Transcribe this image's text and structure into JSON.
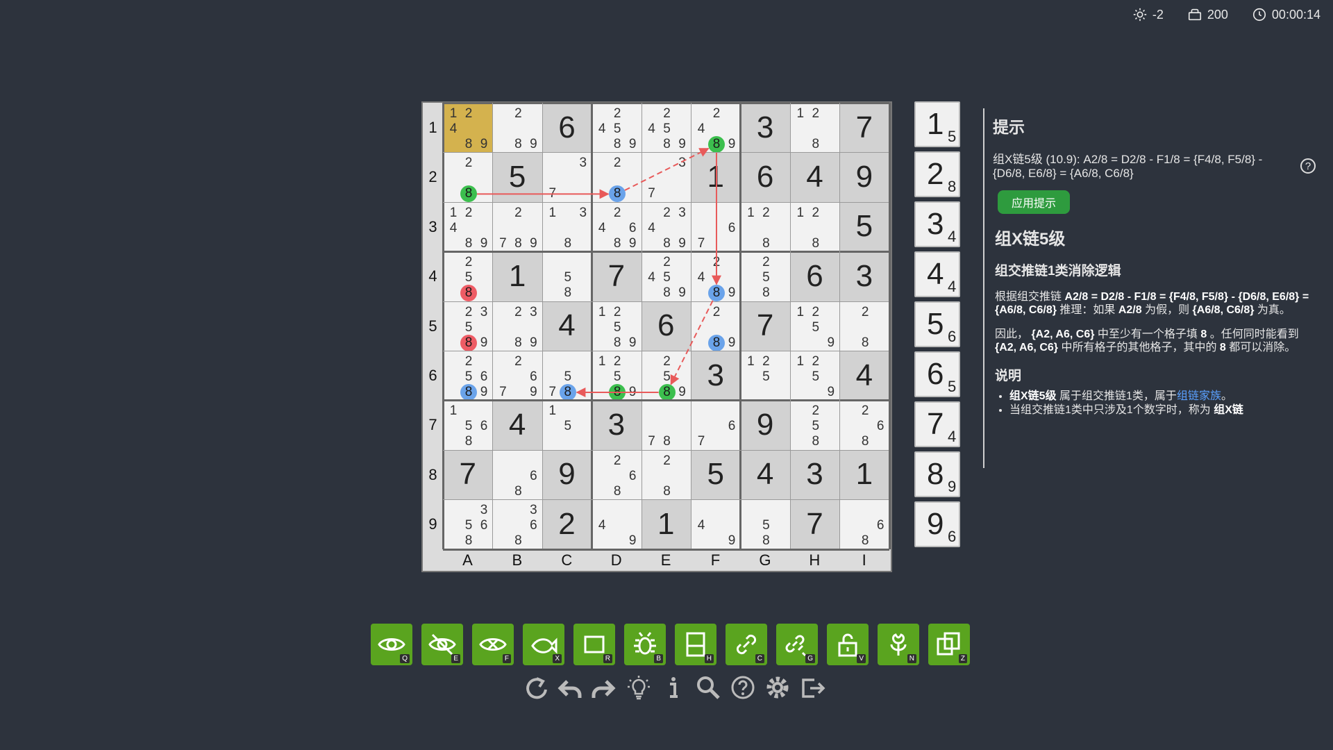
{
  "stats": {
    "brightness": "-2",
    "coins": "200",
    "timer": "00:00:14"
  },
  "board": {
    "row_labels": [
      "1",
      "2",
      "3",
      "4",
      "5",
      "6",
      "7",
      "8",
      "9"
    ],
    "col_labels": [
      "A",
      "B",
      "C",
      "D",
      "E",
      "F",
      "G",
      "H",
      "I"
    ],
    "selected": {
      "r": 0,
      "c": 0
    },
    "cells": [
      [
        {
          "c": [
            1,
            2,
            4,
            8,
            9
          ]
        },
        {
          "c": [
            2,
            8,
            9
          ]
        },
        {
          "v": 6
        },
        {
          "c": [
            2,
            4,
            5,
            8,
            9
          ]
        },
        {
          "c": [
            2,
            4,
            5,
            8,
            9
          ]
        },
        {
          "c": [
            2,
            4,
            8,
            9
          ],
          "hl": {
            "8": "green"
          }
        },
        {
          "v": 3
        },
        {
          "c": [
            1,
            2,
            8
          ]
        },
        {
          "v": 7
        }
      ],
      [
        {
          "c": [
            2,
            8
          ],
          "hl": {
            "8": "green"
          }
        },
        {
          "v": 5
        },
        {
          "c": [
            3,
            7
          ]
        },
        {
          "c": [
            2,
            8
          ],
          "hl": {
            "8": "blue"
          }
        },
        {
          "c": [
            3,
            7
          ]
        },
        {
          "v": 1
        },
        {
          "v": 6
        },
        {
          "v": 4
        },
        {
          "v": 9
        }
      ],
      [
        {
          "c": [
            1,
            2,
            4,
            8,
            9
          ]
        },
        {
          "c": [
            2,
            7,
            8,
            9
          ]
        },
        {
          "c": [
            1,
            3,
            8
          ]
        },
        {
          "c": [
            2,
            4,
            6,
            8,
            9
          ]
        },
        {
          "c": [
            2,
            3,
            4,
            8,
            9
          ]
        },
        {
          "c": [
            6,
            7
          ]
        },
        {
          "c": [
            1,
            2,
            8
          ]
        },
        {
          "c": [
            1,
            2,
            8
          ]
        },
        {
          "v": 5
        }
      ],
      [
        {
          "c": [
            2,
            5,
            8
          ],
          "hl": {
            "8": "red"
          }
        },
        {
          "v": 1
        },
        {
          "c": [
            5,
            8
          ]
        },
        {
          "v": 7
        },
        {
          "c": [
            2,
            4,
            5,
            8,
            9
          ]
        },
        {
          "c": [
            2,
            4,
            8,
            9
          ],
          "hl": {
            "8": "blue"
          }
        },
        {
          "c": [
            2,
            5,
            8
          ]
        },
        {
          "v": 6
        },
        {
          "v": 3
        }
      ],
      [
        {
          "c": [
            2,
            3,
            5,
            8,
            9
          ],
          "hl": {
            "8": "red"
          }
        },
        {
          "c": [
            2,
            3,
            8,
            9
          ]
        },
        {
          "v": 4
        },
        {
          "c": [
            1,
            2,
            5,
            8,
            9
          ]
        },
        {
          "v": 6
        },
        {
          "c": [
            2,
            8,
            9
          ],
          "hl": {
            "8": "blue"
          }
        },
        {
          "v": 7
        },
        {
          "c": [
            1,
            2,
            5,
            9
          ]
        },
        {
          "c": [
            2,
            8
          ]
        }
      ],
      [
        {
          "c": [
            2,
            5,
            6,
            8,
            9
          ],
          "hl": {
            "8": "blue"
          }
        },
        {
          "c": [
            2,
            6,
            7,
            9
          ]
        },
        {
          "c": [
            5,
            7,
            8
          ],
          "hl": {
            "8": "blue"
          }
        },
        {
          "c": [
            1,
            2,
            5,
            8,
            9
          ],
          "hl": {
            "8": "green"
          }
        },
        {
          "c": [
            2,
            5,
            8,
            9
          ],
          "hl": {
            "8": "green"
          }
        },
        {
          "v": 3
        },
        {
          "c": [
            1,
            2,
            5
          ]
        },
        {
          "c": [
            1,
            2,
            5,
            9
          ]
        },
        {
          "v": 4
        }
      ],
      [
        {
          "c": [
            1,
            5,
            6,
            8
          ]
        },
        {
          "v": 4
        },
        {
          "c": [
            1,
            5
          ]
        },
        {
          "v": 3
        },
        {
          "c": [
            7,
            8
          ]
        },
        {
          "c": [
            6,
            7
          ]
        },
        {
          "v": 9
        },
        {
          "c": [
            2,
            5,
            8
          ]
        },
        {
          "c": [
            2,
            6,
            8
          ]
        }
      ],
      [
        {
          "v": 7
        },
        {
          "c": [
            6,
            8
          ]
        },
        {
          "v": 9
        },
        {
          "c": [
            2,
            6,
            8
          ]
        },
        {
          "c": [
            2,
            8
          ]
        },
        {
          "v": 5
        },
        {
          "v": 4
        },
        {
          "v": 3
        },
        {
          "v": 1
        }
      ],
      [
        {
          "c": [
            3,
            5,
            6,
            8
          ]
        },
        {
          "c": [
            3,
            6,
            8
          ]
        },
        {
          "v": 2
        },
        {
          "c": [
            4,
            9
          ]
        },
        {
          "v": 1
        },
        {
          "c": [
            4,
            9
          ]
        },
        {
          "c": [
            5,
            8
          ]
        },
        {
          "v": 7
        },
        {
          "c": [
            6,
            8
          ]
        }
      ]
    ],
    "chain": [
      {
        "from": {
          "r": 1,
          "c": 0,
          "n": 8
        },
        "to": {
          "r": 1,
          "c": 3,
          "n": 8
        },
        "style": "solid"
      },
      {
        "from": {
          "r": 1,
          "c": 3,
          "n": 8
        },
        "to": {
          "r": 0,
          "c": 5,
          "n": 8
        },
        "style": "dashed"
      },
      {
        "from": {
          "r": 0,
          "c": 5,
          "n": 8
        },
        "to": {
          "r": 3,
          "c": 5,
          "n": 8
        },
        "style": "solid"
      },
      {
        "from": {
          "r": 3,
          "c": 5,
          "n": 8
        },
        "to": {
          "r": 5,
          "c": 4,
          "n": 8
        },
        "style": "dashed"
      },
      {
        "from": {
          "r": 5,
          "c": 4,
          "n": 8
        },
        "to": {
          "r": 5,
          "c": 2,
          "n": 8
        },
        "style": "solid"
      }
    ]
  },
  "numpad": [
    {
      "n": "1",
      "count": "5"
    },
    {
      "n": "2",
      "count": "8"
    },
    {
      "n": "3",
      "count": "4"
    },
    {
      "n": "4",
      "count": "4"
    },
    {
      "n": "5",
      "count": "6"
    },
    {
      "n": "6",
      "count": "5"
    },
    {
      "n": "7",
      "count": "4"
    },
    {
      "n": "8",
      "count": "9"
    },
    {
      "n": "9",
      "count": "6"
    }
  ],
  "hint": {
    "title": "提示",
    "summary": "组X链5级 (10.9): A2/8 = D2/8 - F1/8 = {F4/8, F5/8} - {D6/8, E6/8} = {A6/8, C6/8}",
    "help": "?",
    "apply_label": "应用提示",
    "h1": "组X链5级",
    "h2": "组交推链1类消除逻辑",
    "p1_a": "根据组交推链 ",
    "p1_b": "A2/8 = D2/8 - F1/8 = {F4/8, F5/8} - {D6/8, E6/8} = {A6/8, C6/8}",
    "p1_c": " 推理：如果 ",
    "p1_d": "A2/8",
    "p1_e": " 为假，则 ",
    "p1_f": "{A6/8, C6/8}",
    "p1_g": " 为真。",
    "p2_a": "因此， ",
    "p2_b": "{A2, A6, C6}",
    "p2_c": " 中至少有一个格子填 ",
    "p2_d": "8",
    "p2_e": " 。任何同时能看到 ",
    "p2_f": "{A2, A6, C6}",
    "p2_g": " 中所有格子的其他格子，其中的 ",
    "p2_h": "8",
    "p2_i": " 都可以消除。",
    "h3": "说明",
    "li1_a": "组X链5级",
    "li1_b": " 属于组交推链1类，属于",
    "li1_link": "组链家族",
    "li1_c": "。",
    "li2_a": "当组交推链1类中只涉及1个数字时，称为 ",
    "li2_b": "组X链"
  },
  "tools": [
    {
      "name": "eye",
      "key": "Q"
    },
    {
      "name": "eye-off",
      "key": "E"
    },
    {
      "name": "eye-filter",
      "key": "F"
    },
    {
      "name": "fish",
      "key": "X"
    },
    {
      "name": "rectangle",
      "key": "R"
    },
    {
      "name": "bug",
      "key": "B"
    },
    {
      "name": "split-box",
      "key": "H"
    },
    {
      "name": "link",
      "key": "C"
    },
    {
      "name": "link-group",
      "key": "G"
    },
    {
      "name": "unlock",
      "key": "V"
    },
    {
      "name": "flower",
      "key": "N"
    },
    {
      "name": "copy",
      "key": "Z"
    }
  ],
  "bottom_icons": [
    "restart-icon",
    "undo-icon",
    "redo-icon",
    "hint-bulb-icon",
    "info-icon",
    "search-icon",
    "help-icon",
    "settings-icon",
    "exit-icon"
  ],
  "colors": {
    "background": "#2d333d",
    "tool_green": "#5aa41f",
    "selected_cell": "#d4b24e",
    "chain": "#e85a5a",
    "hl_green": "#3cbf4e",
    "hl_blue": "#6aa3ea",
    "hl_red": "#ee5c65"
  }
}
